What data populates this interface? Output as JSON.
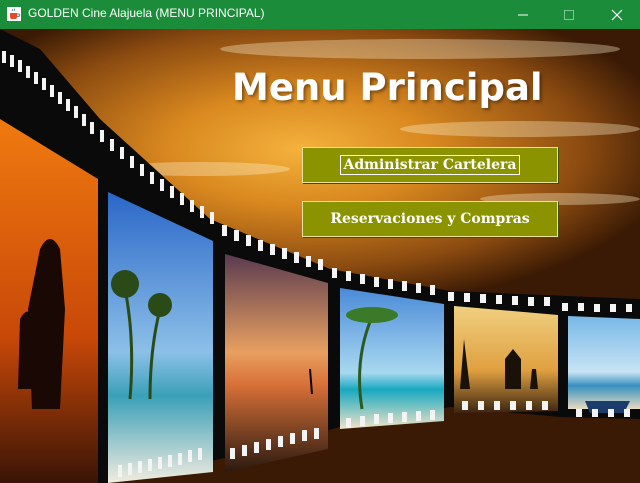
{
  "window": {
    "title": "GOLDEN Cine Alajuela (MENU PRINCIPAL)",
    "accent": "#1b8c3a"
  },
  "main": {
    "heading": "Menu Principal",
    "buttons": {
      "admin_label": "Administrar Cartelera",
      "reservations_label": "Reservaciones y Compras"
    },
    "button_color": "#8b9400"
  },
  "icons": {
    "app": "java-cup-icon",
    "minimize": "minimize-icon",
    "maximize": "maximize-icon",
    "close": "close-icon"
  }
}
